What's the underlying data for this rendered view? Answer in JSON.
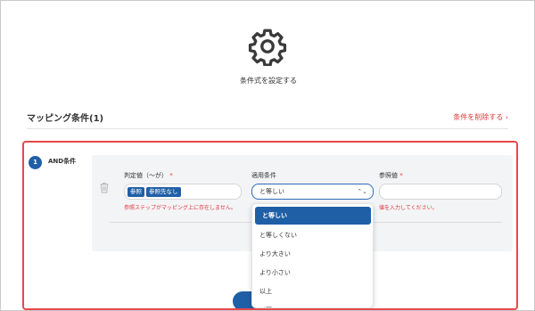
{
  "heading": "条件式を設定する",
  "section": {
    "title": "マッピング条件(1)",
    "delete_link": "条件を削除する ›"
  },
  "condition": {
    "step": "1",
    "type_label": "AND条件",
    "judge": {
      "label": "判定値（〜が）",
      "required": "*",
      "chip1": "参照",
      "chip2": "参照先なし",
      "error": "参照ステップがマッピング上に存在しません。"
    },
    "apply": {
      "label": "適用条件",
      "value": "と等しい",
      "arrows": "⌃⌄"
    },
    "ref": {
      "label": "参照値",
      "required": "*",
      "error": "値を入力してください。"
    }
  },
  "dropdown": {
    "options": [
      "と等しい",
      "と等しくない",
      "より大きい",
      "より小さい",
      "以上",
      "以下"
    ],
    "selected_index": 0
  },
  "colors": {
    "accent": "#1f5fa6",
    "error": "#e0383e",
    "highlight_border": "#e8474d"
  }
}
